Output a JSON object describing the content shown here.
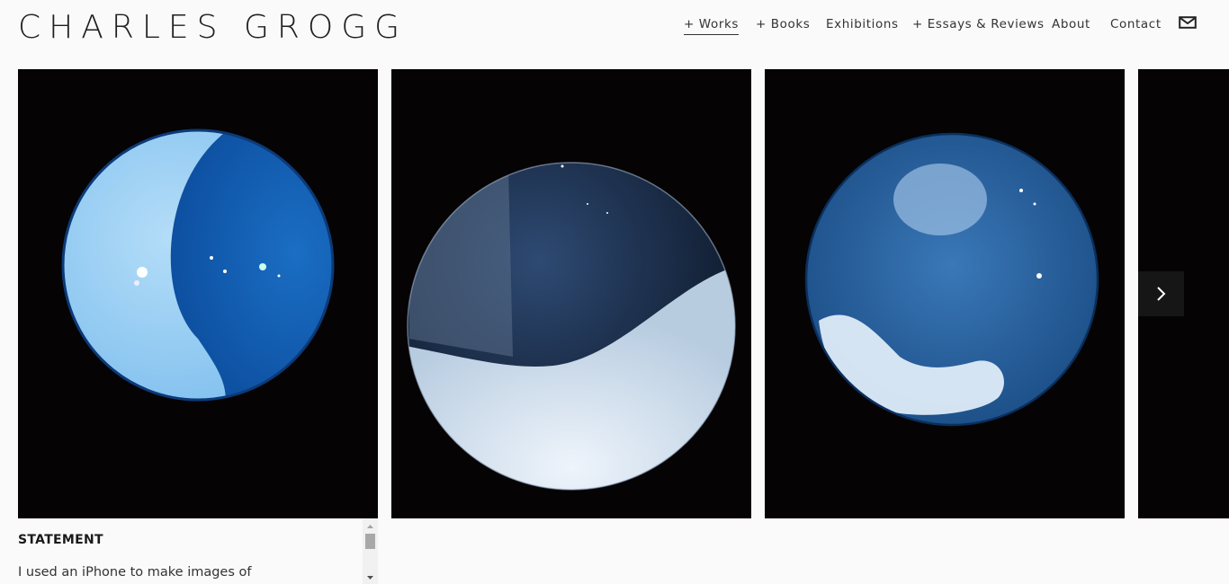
{
  "header": {
    "site_title": "CHARLES GROGG",
    "nav": [
      {
        "label": "+ Works",
        "active": true
      },
      {
        "label": "+ Books",
        "active": false
      },
      {
        "label": "Exhibitions",
        "active": false
      },
      {
        "label": "+ Essays & Reviews",
        "active": false
      },
      {
        "label": "About",
        "active": false
      },
      {
        "label": "Contact",
        "active": false
      }
    ],
    "mail_icon": "envelope-icon"
  },
  "gallery": {
    "slides": [
      {
        "description_icon": "blue-sphere-half-light"
      },
      {
        "description_icon": "dark-sphere-lower-white"
      },
      {
        "description_icon": "blue-sphere-clouds"
      },
      {
        "description_icon": "partial-slide"
      }
    ],
    "next_icon": "chevron-right-icon"
  },
  "statement": {
    "heading": "STATEMENT",
    "text": "I used an iPhone to make images of"
  },
  "colors": {
    "background": "#fafafa",
    "slide_bg": "#050304",
    "arrow_bg": "#161616"
  }
}
